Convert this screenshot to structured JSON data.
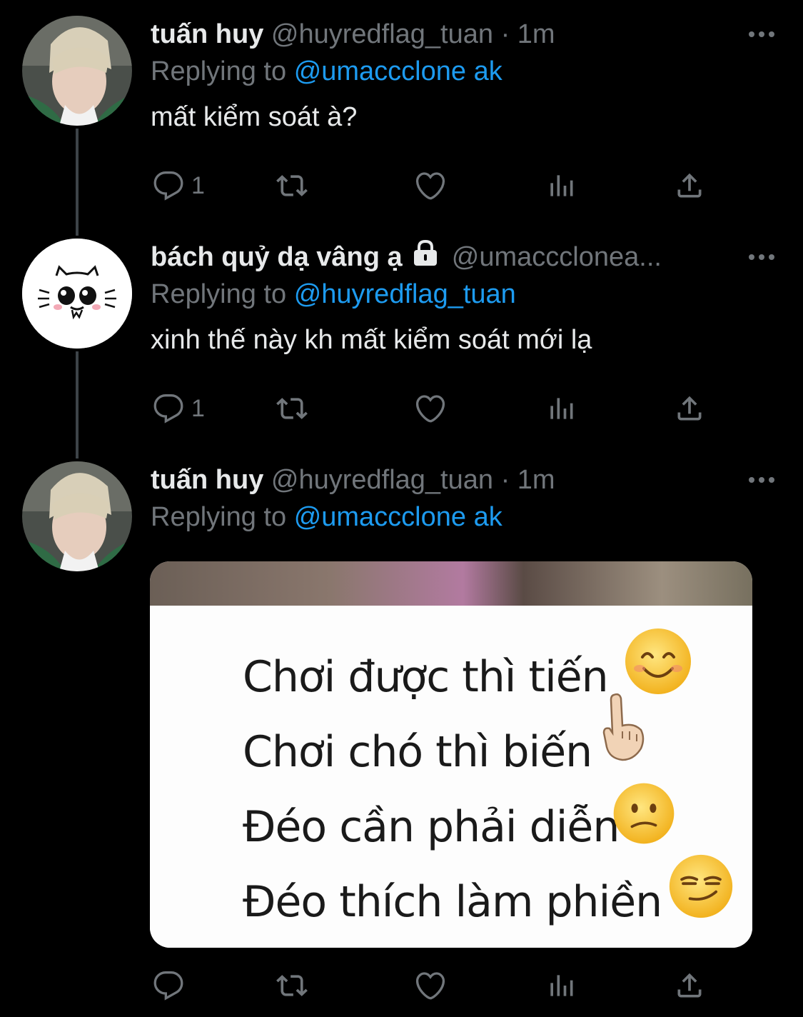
{
  "tweets": [
    {
      "name": "tuấn huy",
      "handle": "@huyredflag_tuan",
      "separator": "·",
      "time": "1m",
      "reply_prefix": "Replying to",
      "reply_to": "@umaccclone ak",
      "text": "mất kiểm soát à?",
      "reply_count": "1"
    },
    {
      "name": "bách quỷ dạ vâng ạ",
      "handle": "@umaccclonea...",
      "reply_prefix": "Replying to",
      "reply_to": "@huyredflag_tuan",
      "text": "xinh thế này kh mất kiểm soát mới lạ",
      "reply_count": "1"
    },
    {
      "name": "tuấn huy",
      "handle": "@huyredflag_tuan",
      "separator": "·",
      "time": "1m",
      "reply_prefix": "Replying to",
      "reply_to": "@umaccclone ak",
      "reply_count": ""
    }
  ],
  "media": {
    "lines": [
      "Chơi được thì tiến",
      "Chơi chó thì biến",
      "Đéo cần phải diễn",
      "Đéo thích làm phiền"
    ]
  },
  "icons": {
    "reply": "reply-icon",
    "retweet": "retweet-icon",
    "like": "heart-icon",
    "views": "analytics-icon",
    "share": "share-icon",
    "more": "more-icon",
    "lock": "lock-icon"
  },
  "colors": {
    "background": "#000000",
    "text": "#e7e9ea",
    "muted": "#71767b",
    "link": "#1d9bf0"
  }
}
